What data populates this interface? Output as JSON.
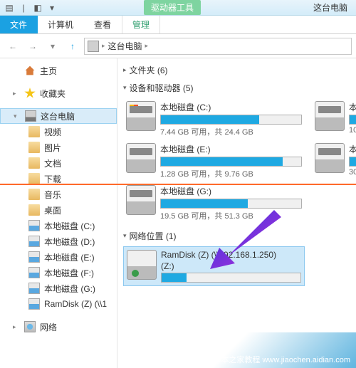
{
  "titlebar": {
    "context_tab": "驱动器工具",
    "title": "这台电脑"
  },
  "ribbon": {
    "file": "文件",
    "computer": "计算机",
    "view": "查看",
    "manage": "管理"
  },
  "address": {
    "location": "这台电脑"
  },
  "sidebar": {
    "favorites": "收藏夹",
    "home": "主页",
    "thispc": "这台电脑",
    "items": [
      {
        "label": "视频"
      },
      {
        "label": "图片"
      },
      {
        "label": "文档"
      },
      {
        "label": "下载"
      },
      {
        "label": "音乐"
      },
      {
        "label": "桌面"
      },
      {
        "label": "本地磁盘 (C:)"
      },
      {
        "label": "本地磁盘 (D:)"
      },
      {
        "label": "本地磁盘 (E:)"
      },
      {
        "label": "本地磁盘 (F:)"
      },
      {
        "label": "本地磁盘 (G:)"
      },
      {
        "label": "RamDisk (Z) (\\\\1"
      }
    ],
    "network": "网络"
  },
  "sections": {
    "folders": "文件夹 (6)",
    "drives_hdr": "设备和驱动器 (5)",
    "netloc_hdr": "网络位置 (1)",
    "drives": [
      {
        "name": "本地磁盘 (C:)",
        "stat": "7.44 GB 可用，共 24.4 GB",
        "fill": 70
      },
      {
        "name": "本地磁盘 (E:)",
        "stat": "1.28 GB 可用，共 9.76 GB",
        "fill": 87
      },
      {
        "name": "本地磁盘 (G:)",
        "stat": "19.5 GB 可用，共 51.3 GB",
        "fill": 62
      }
    ],
    "drives_right": [
      {
        "name": "本",
        "stat": "10",
        "fill": 40
      },
      {
        "name": "本",
        "stat": "30",
        "fill": 20
      }
    ],
    "netloc": {
      "name": "RamDisk (Z) (\\\\192.168.1.250)",
      "sub": "(Z:)",
      "fill": 18
    }
  },
  "watermark": "脚本之家教程 www.jiaochen.aidian.com"
}
